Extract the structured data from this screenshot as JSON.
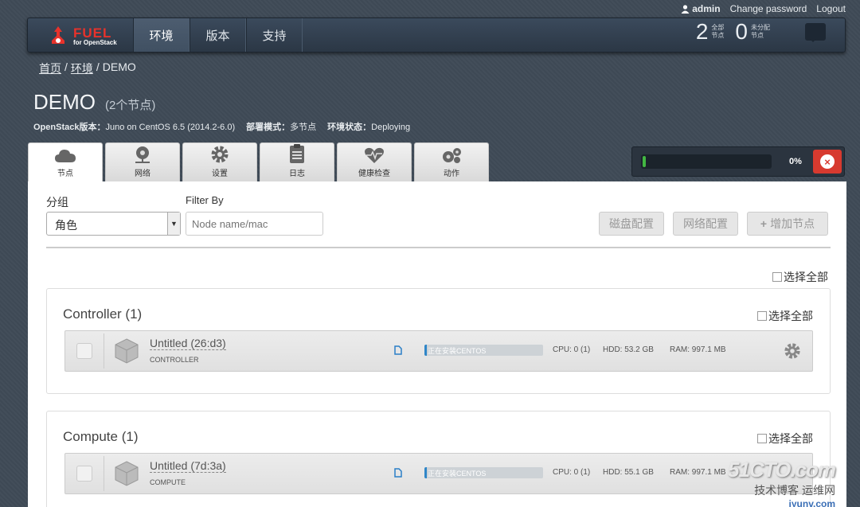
{
  "userbar": {
    "user": "admin",
    "change_password": "Change password",
    "logout": "Logout"
  },
  "logo": {
    "main": "FUEL",
    "sub": "for OpenStack"
  },
  "nav": {
    "tabs": [
      {
        "label": "环境"
      },
      {
        "label": "版本"
      },
      {
        "label": "支持"
      }
    ]
  },
  "stats": {
    "total_num": "2",
    "total_label_1": "全部",
    "total_label_2": "节点",
    "unalloc_num": "0",
    "unalloc_label_1": "未分配",
    "unalloc_label_2": "节点"
  },
  "breadcrumb": {
    "home": "首页",
    "env": "环境",
    "current": "DEMO",
    "sep": "/"
  },
  "env": {
    "name": "DEMO",
    "node_count": "(2个节点)",
    "os_label": "OpenStack版本：",
    "os_value": "Juno on CentOS 6.5 (2014.2-6.0)",
    "mode_label": "部署模式：",
    "mode_value": "多节点",
    "status_label": "环境状态：",
    "status_value": "Deploying"
  },
  "tabs": [
    {
      "label": "节点",
      "icon": "cloud-icon"
    },
    {
      "label": "网络",
      "icon": "network-icon"
    },
    {
      "label": "设置",
      "icon": "gear-icon"
    },
    {
      "label": "日志",
      "icon": "clipboard-icon"
    },
    {
      "label": "健康检查",
      "icon": "heart-icon"
    },
    {
      "label": "动作",
      "icon": "gears-icon"
    }
  ],
  "deploy": {
    "percent": "0%",
    "progress": 0.0
  },
  "toolbar": {
    "group_label": "分组",
    "group_value": "角色",
    "filter_label": "Filter By",
    "filter_placeholder": "Node name/mac",
    "disk_btn": "磁盘配置",
    "net_btn": "网络配置",
    "add_btn": "增加节点",
    "select_all": "选择全部"
  },
  "groups": [
    {
      "title": "Controller (1)",
      "select_all": "选择全部",
      "node": {
        "name": "Untitled (26:d3)",
        "role": "CONTROLLER",
        "status": "正在安装CENTOS",
        "progress": 0.02,
        "cpu": "CPU: 0 (1)",
        "hdd": "HDD: 53.2 GB",
        "ram": "RAM: 997.1 MB"
      }
    },
    {
      "title": "Compute (1)",
      "select_all": "选择全部",
      "node": {
        "name": "Untitled (7d:3a)",
        "role": "COMPUTE",
        "status": "正在安装CENTOS",
        "progress": 0.02,
        "cpu": "CPU: 0 (1)",
        "hdd": "HDD: 55.1 GB",
        "ram": "RAM: 997.1 MB"
      }
    }
  ],
  "watermark": {
    "main": "51CTO.com",
    "sub": "技术博客 运维网",
    "url": "iyunv.com"
  }
}
